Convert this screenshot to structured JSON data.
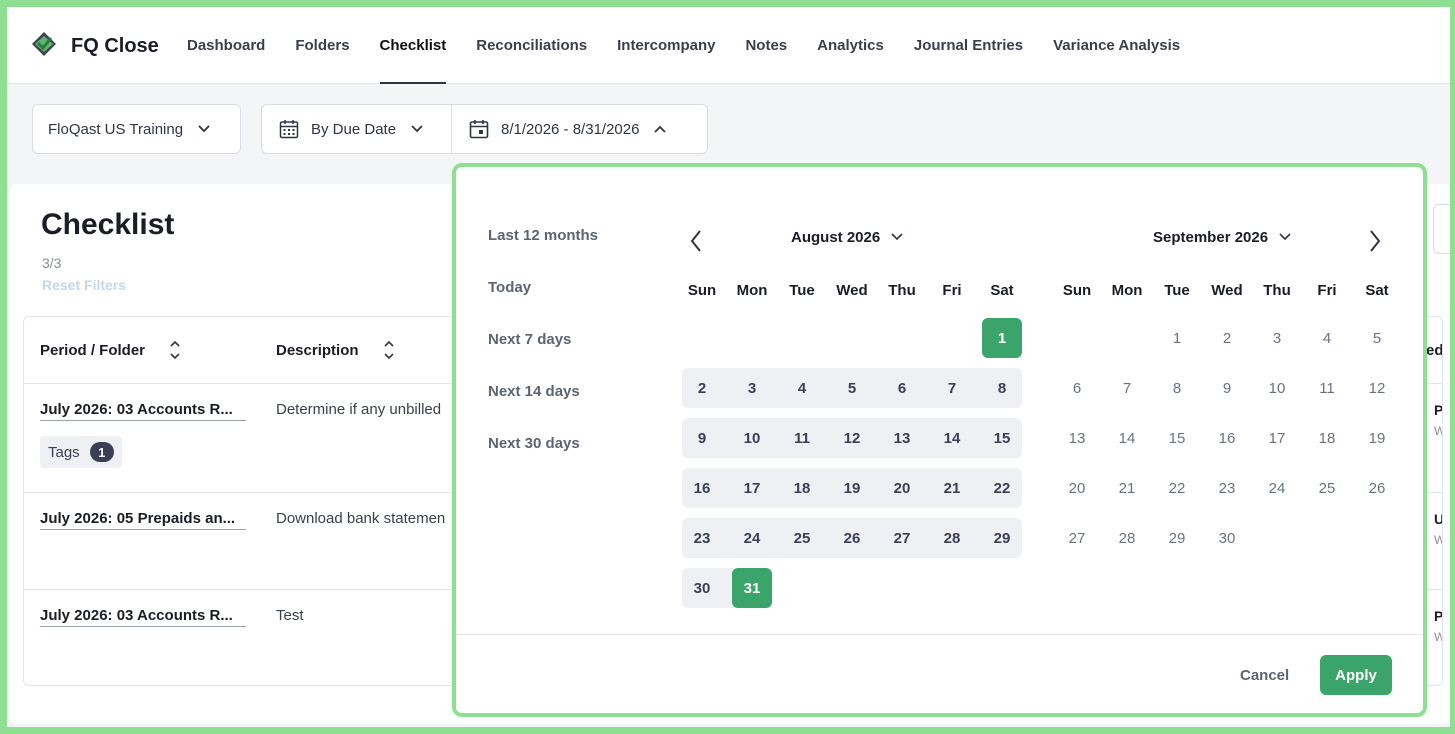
{
  "app": {
    "title": "FQ Close"
  },
  "nav": {
    "items": [
      {
        "label": "Dashboard",
        "name": "nav-dashboard"
      },
      {
        "label": "Folders",
        "name": "nav-folders"
      },
      {
        "label": "Checklist",
        "name": "nav-checklist",
        "active": true
      },
      {
        "label": "Reconciliations",
        "name": "nav-reconciliations"
      },
      {
        "label": "Intercompany",
        "name": "nav-intercompany"
      },
      {
        "label": "Notes",
        "name": "nav-notes"
      },
      {
        "label": "Analytics",
        "name": "nav-analytics"
      },
      {
        "label": "Journal Entries",
        "name": "nav-journal-entries"
      },
      {
        "label": "Variance Analysis",
        "name": "nav-variance-analysis"
      }
    ]
  },
  "filters": {
    "entity": "FloQast US Training",
    "date_mode": "By Due Date",
    "range": "8/1/2026 - 8/31/2026"
  },
  "checklist": {
    "title": "Checklist",
    "count": "3/3",
    "reset": "Reset Filters",
    "headers": {
      "period": "Period / Folder",
      "description": "Description",
      "status_partial": "ted"
    },
    "rows": [
      {
        "period": "July 2026: 03 Accounts R...",
        "description": "Determine if any unbilled",
        "tags_label": "Tags",
        "tags_count": "1",
        "status": "Prep",
        "sub": "Waiti"
      },
      {
        "period": "July 2026: 05 Prepaids an...",
        "description": "Download bank statemen",
        "status": "Una",
        "sub": "Waiti"
      },
      {
        "period": "July 2026: 03 Accounts R...",
        "description": "Test",
        "status": "Prep",
        "sub": "Waiti"
      }
    ]
  },
  "picker": {
    "quick": [
      "Last 12 months",
      "Today",
      "Next 7 days",
      "Next 14 days",
      "Next 30 days"
    ],
    "left_month": "August 2026",
    "right_month": "September 2026",
    "dow": [
      "Sun",
      "Mon",
      "Tue",
      "Wed",
      "Thu",
      "Fri",
      "Sat"
    ],
    "august_start_dow": 6,
    "august_days": 31,
    "september_start_dow": 2,
    "september_days": 30,
    "selected_start": 1,
    "selected_end": 31,
    "cancel": "Cancel",
    "apply": "Apply"
  },
  "colors": {
    "accent": "#3ba46a",
    "frame": "#8fdf92"
  }
}
